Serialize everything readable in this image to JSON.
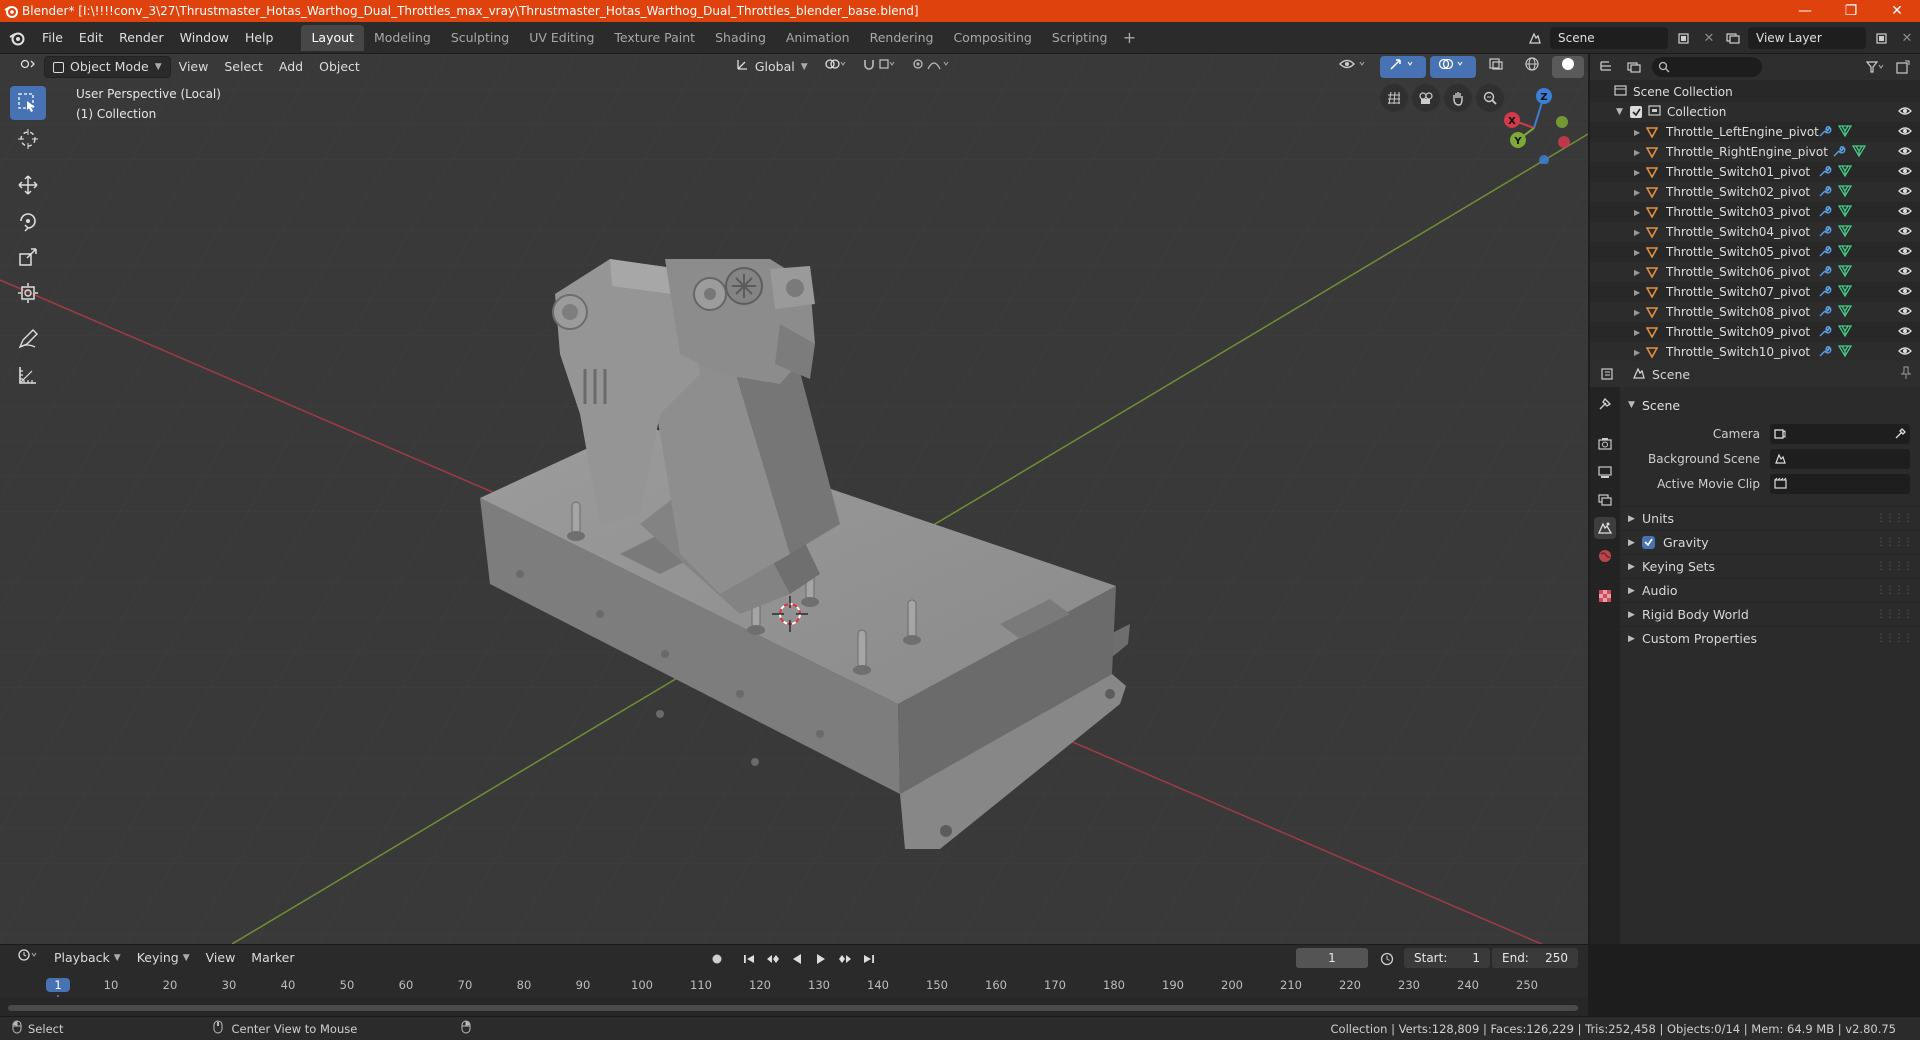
{
  "window": {
    "title": "Blender* [I:\\!!!!conv_3\\27\\Thrustmaster_Hotas_Warthog_Dual_Throttles_max_vray\\Thrustmaster_Hotas_Warthog_Dual_Throttles_blender_base.blend]",
    "minimize": "—",
    "maximize": "❐",
    "close": "✕"
  },
  "menu": [
    "File",
    "Edit",
    "Render",
    "Window",
    "Help"
  ],
  "workspaces": [
    "Layout",
    "Modeling",
    "Sculpting",
    "UV Editing",
    "Texture Paint",
    "Shading",
    "Animation",
    "Rendering",
    "Compositing",
    "Scripting"
  ],
  "workspace_add": "+",
  "scene_field": "Scene",
  "view_layer_field": "View Layer",
  "viewport": {
    "mode": "Object Mode",
    "menus": [
      "View",
      "Select",
      "Add",
      "Object"
    ],
    "orientation": "Global",
    "info_line1": "User Perspective (Local)",
    "info_line2": "(1) Collection",
    "axes": {
      "x": "X",
      "y": "Y",
      "z": "Z"
    }
  },
  "outliner": {
    "root": "Scene Collection",
    "collection": "Collection",
    "items": [
      "Throttle_LeftEngine_pivot",
      "Throttle_RightEngine_pivot",
      "Throttle_Switch01_pivot",
      "Throttle_Switch02_pivot",
      "Throttle_Switch03_pivot",
      "Throttle_Switch04_pivot",
      "Throttle_Switch05_pivot",
      "Throttle_Switch06_pivot",
      "Throttle_Switch07_pivot",
      "Throttle_Switch08_pivot",
      "Throttle_Switch09_pivot",
      "Throttle_Switch10_pivot"
    ]
  },
  "properties": {
    "context": "Scene",
    "panel": "Scene",
    "camera_label": "Camera",
    "background_scene_label": "Background Scene",
    "active_movie_clip_label": "Active Movie Clip",
    "subpanels": {
      "units": "Units",
      "gravity": "Gravity",
      "keying_sets": "Keying Sets",
      "audio": "Audio",
      "rigid_body_world": "Rigid Body World",
      "custom_properties": "Custom Properties"
    },
    "gravity_checked": true
  },
  "timeline": {
    "menus": [
      "Playback",
      "Keying",
      "View",
      "Marker"
    ],
    "current_frame": "1",
    "start_label": "Start:",
    "start": "1",
    "end_label": "End:",
    "end": "250",
    "ticks": [
      "1",
      "10",
      "20",
      "30",
      "40",
      "50",
      "60",
      "70",
      "80",
      "90",
      "100",
      "110",
      "120",
      "130",
      "140",
      "150",
      "160",
      "170",
      "180",
      "190",
      "200",
      "210",
      "220",
      "230",
      "240",
      "250"
    ]
  },
  "status": {
    "select": "Select",
    "center_view": "Center View to Mouse",
    "stats": "Collection | Verts:128,809 | Faces:126,229 | Tris:252,458 | Objects:0/14 | Mem: 64.9 MB | v2.80.75"
  },
  "colors": {
    "title_bar": "#e0420e",
    "accent": "#4772b3",
    "x_axis": "#d2394b",
    "y_axis": "#7fa935",
    "z_axis": "#3b7fd6",
    "object_icon": "#e38f3e",
    "modifier_icon": "#5aa0e6",
    "mesh_icon": "#46c985"
  }
}
